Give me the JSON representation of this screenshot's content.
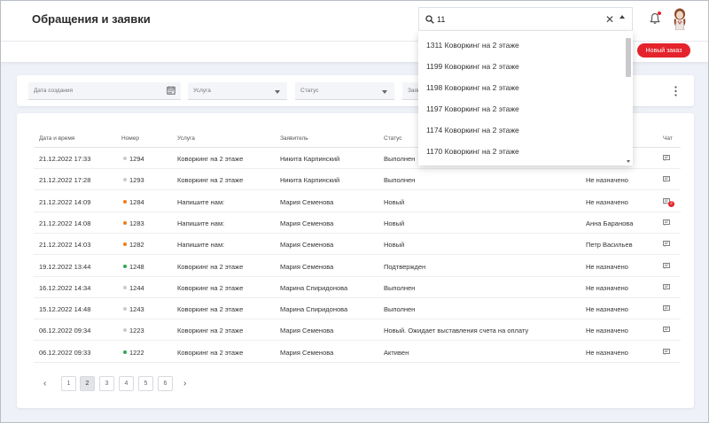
{
  "header": {
    "title": "Обращения и заявки",
    "new_order_label": "Новый заказ"
  },
  "search": {
    "value": "11",
    "clear_icon": "close-icon",
    "suggestions": [
      "1311 Коворкинг на 2 этаже",
      "1199 Коворкинг на 2 этаже",
      "1198 Коворкинг на 2 этаже",
      "1197 Коворкинг на 2 этаже",
      "1174 Коворкинг на 2 этаже",
      "1170 Коворкинг на 2 этаже"
    ]
  },
  "filters": {
    "date_label": "Дата создания",
    "service_label": "Услуга",
    "status_label": "Статус",
    "applicant_label": "Заяв"
  },
  "table": {
    "headers": {
      "date": "Дата и время",
      "number": "Номер",
      "service": "Услуга",
      "applicant": "Заявитель",
      "status": "Статус",
      "chat": "Чат"
    },
    "rows": [
      {
        "date": "21.12.2022 17:33",
        "number": "1294",
        "dot": "#c8cbd2",
        "service": "Коворкинг на 2 этаже",
        "applicant": "Никита Карпинский",
        "status": "Выполнен",
        "assignee": "",
        "badge": ""
      },
      {
        "date": "21.12.2022 17:28",
        "number": "1293",
        "dot": "#c8cbd2",
        "service": "Коворкинг на 2 этаже",
        "applicant": "Никита Карпинский",
        "status": "Выполнен",
        "assignee": "Не назначено",
        "badge": ""
      },
      {
        "date": "21.12.2022 14:09",
        "number": "1284",
        "dot": "#f07c1a",
        "service": "Напишите нам:",
        "applicant": "Мария Семенова",
        "status": "Новый",
        "assignee": "Не назначено",
        "badge": "2"
      },
      {
        "date": "21.12.2022 14:08",
        "number": "1283",
        "dot": "#f07c1a",
        "service": "Напишите нам:",
        "applicant": "Мария Семенова",
        "status": "Новый",
        "assignee": "Анна Баранова",
        "badge": ""
      },
      {
        "date": "21.12.2022 14:03",
        "number": "1282",
        "dot": "#f07c1a",
        "service": "Напишите нам:",
        "applicant": "Мария Семенова",
        "status": "Новый",
        "assignee": "Петр Васильев",
        "badge": ""
      },
      {
        "date": "19.12.2022 13:44",
        "number": "1248",
        "dot": "#2fa84f",
        "service": "Коворкинг на 2 этаже",
        "applicant": "Мария Семенова",
        "status": "Подтвержден",
        "assignee": "Не назначено",
        "badge": ""
      },
      {
        "date": "16.12.2022 14:34",
        "number": "1244",
        "dot": "#c8cbd2",
        "service": "Коворкинг на 2 этаже",
        "applicant": "Марина Спиридонова",
        "status": "Выполнен",
        "assignee": "Не назначено",
        "badge": ""
      },
      {
        "date": "15.12.2022 14:48",
        "number": "1243",
        "dot": "#c8cbd2",
        "service": "Коворкинг на 2 этаже",
        "applicant": "Марина Спиридонова",
        "status": "Выполнен",
        "assignee": "Не назначено",
        "badge": ""
      },
      {
        "date": "06.12.2022 09:34",
        "number": "1223",
        "dot": "#c8cbd2",
        "service": "Коворкинг на 2 этаже",
        "applicant": "Мария Семенова",
        "status": "Новый. Ожидает выставления счета на оплату",
        "assignee": "Не назначено",
        "badge": ""
      },
      {
        "date": "06.12.2022 09:33",
        "number": "1222",
        "dot": "#2fa84f",
        "service": "Коворкинг на 2 этаже",
        "applicant": "Мария Семенова",
        "status": "Активен",
        "assignee": "Не назначено",
        "badge": ""
      }
    ]
  },
  "pagination": {
    "prev": "‹",
    "next": "›",
    "pages": [
      "1",
      "2",
      "3",
      "4",
      "5",
      "6"
    ],
    "current": "2"
  },
  "colors": {
    "accent": "#e4232c",
    "orange": "#f07c1a",
    "green": "#2fa84f"
  }
}
